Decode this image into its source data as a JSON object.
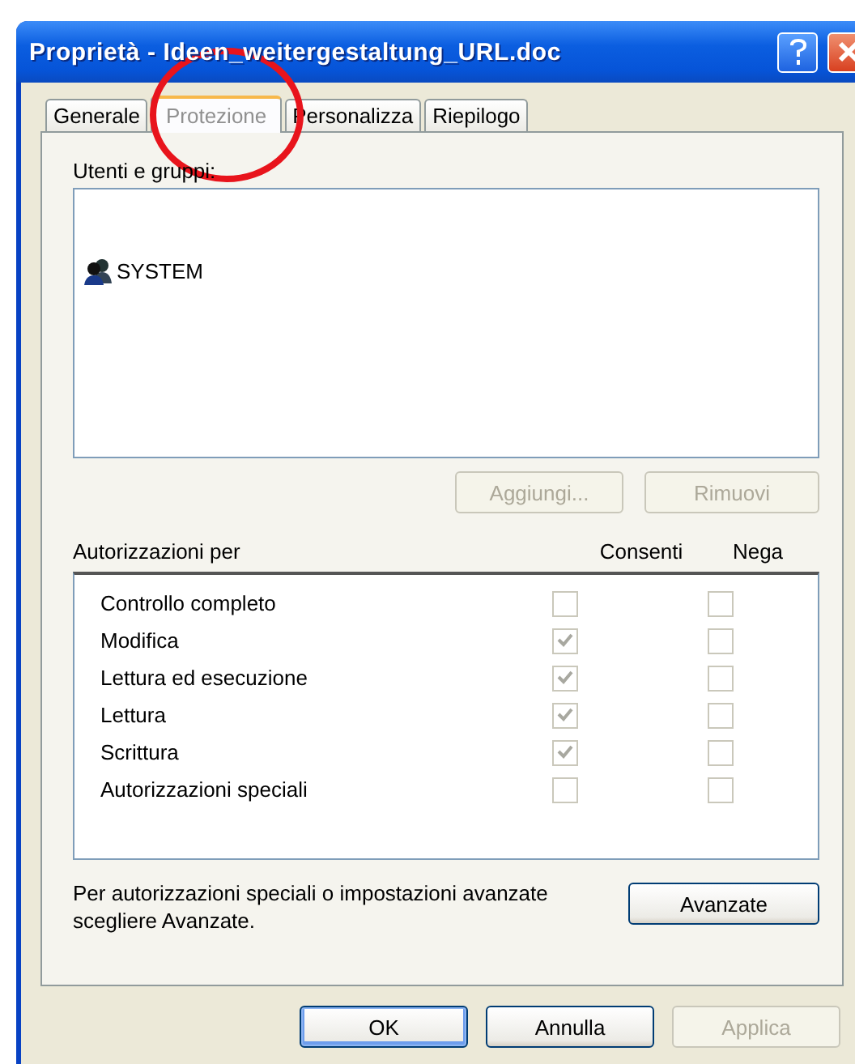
{
  "window": {
    "title": "Proprietà - Ideen_weitergestaltung_URL.doc"
  },
  "tabs": [
    {
      "label": "Generale",
      "selected": false
    },
    {
      "label": "Protezione",
      "selected": true
    },
    {
      "label": "Personalizza",
      "selected": false
    },
    {
      "label": "Riepilogo",
      "selected": false
    }
  ],
  "highlight": {
    "kind": "circle"
  },
  "users_label": "Utenti e gruppi:",
  "users": [
    {
      "name": "SYSTEM"
    }
  ],
  "user_buttons": [
    {
      "label": "Aggiungi...",
      "disabled": true
    },
    {
      "label": "Rimuovi",
      "disabled": true
    }
  ],
  "permissions_header": {
    "label": "Autorizzazioni per",
    "allow": "Consenti",
    "deny": "Nega"
  },
  "permissions": [
    {
      "name": "Controllo completo",
      "allow": false,
      "deny": false,
      "disabled": true
    },
    {
      "name": "Modifica",
      "allow": true,
      "deny": false,
      "disabled": true
    },
    {
      "name": "Lettura ed esecuzione",
      "allow": true,
      "deny": false,
      "disabled": true
    },
    {
      "name": "Lettura",
      "allow": true,
      "deny": false,
      "disabled": true
    },
    {
      "name": "Scrittura",
      "allow": true,
      "deny": false,
      "disabled": true
    },
    {
      "name": "Autorizzazioni speciali",
      "allow": false,
      "deny": false,
      "disabled": true
    }
  ],
  "advanced_note": "Per autorizzazioni speciali o impostazioni avanzate scegliere Avanzate.",
  "advanced_button": {
    "label": "Avanzate",
    "disabled": false
  },
  "buttons": [
    {
      "label": "OK",
      "disabled": false,
      "default": true
    },
    {
      "label": "Annulla",
      "disabled": false,
      "default": false
    },
    {
      "label": "Applica",
      "disabled": true,
      "default": false
    }
  ]
}
